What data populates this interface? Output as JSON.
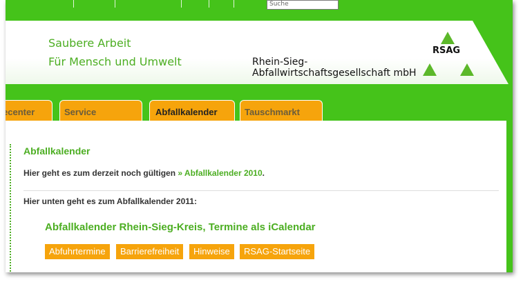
{
  "header": {
    "search_value": "Suche",
    "slogan_line1": "Saubere Arbeit",
    "slogan_line2": "Für Mensch und Umwelt",
    "company_line1": "Rhein-Sieg-",
    "company_line2": "Abfallwirtschaftsgesellschaft mbH",
    "logo_text": "RSAG",
    "brand_green": "#45c31a",
    "accent_orange": "#f6a40c"
  },
  "tabs": [
    {
      "label": "Servicecenter",
      "active": false
    },
    {
      "label": "Service",
      "active": false
    },
    {
      "label": "Abfallkalender",
      "active": true
    },
    {
      "label": "Tauschmarkt",
      "active": false
    }
  ],
  "content": {
    "heading": "Abfallkalender",
    "para1_text": "Hier geht es zum derzeit noch gültigen ",
    "para1_link": "» Abfallkalender 2010",
    "para1_end": ".",
    "para2_text": "Hier unten geht es zum Abfallkalender 2011:",
    "calendar_heading": "Abfallkalender Rhein-Sieg-Kreis, Termine als iCalendar",
    "buttons": [
      "Abfuhrtermine",
      "Barrierefreiheit",
      "Hinweise",
      "RSAG-Startseite"
    ]
  }
}
